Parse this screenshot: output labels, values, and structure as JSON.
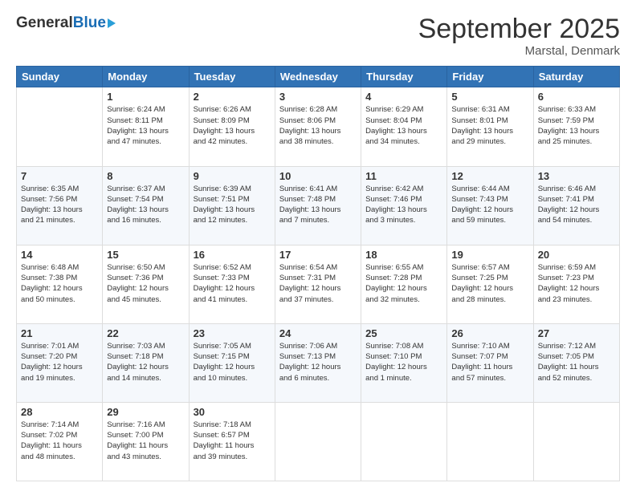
{
  "header": {
    "logo_general": "General",
    "logo_blue": "Blue",
    "title": "September 2025",
    "subtitle": "Marstal, Denmark"
  },
  "days_of_week": [
    "Sunday",
    "Monday",
    "Tuesday",
    "Wednesday",
    "Thursday",
    "Friday",
    "Saturday"
  ],
  "weeks": [
    [
      {
        "day": "",
        "info": ""
      },
      {
        "day": "1",
        "info": "Sunrise: 6:24 AM\nSunset: 8:11 PM\nDaylight: 13 hours\nand 47 minutes."
      },
      {
        "day": "2",
        "info": "Sunrise: 6:26 AM\nSunset: 8:09 PM\nDaylight: 13 hours\nand 42 minutes."
      },
      {
        "day": "3",
        "info": "Sunrise: 6:28 AM\nSunset: 8:06 PM\nDaylight: 13 hours\nand 38 minutes."
      },
      {
        "day": "4",
        "info": "Sunrise: 6:29 AM\nSunset: 8:04 PM\nDaylight: 13 hours\nand 34 minutes."
      },
      {
        "day": "5",
        "info": "Sunrise: 6:31 AM\nSunset: 8:01 PM\nDaylight: 13 hours\nand 29 minutes."
      },
      {
        "day": "6",
        "info": "Sunrise: 6:33 AM\nSunset: 7:59 PM\nDaylight: 13 hours\nand 25 minutes."
      }
    ],
    [
      {
        "day": "7",
        "info": "Sunrise: 6:35 AM\nSunset: 7:56 PM\nDaylight: 13 hours\nand 21 minutes."
      },
      {
        "day": "8",
        "info": "Sunrise: 6:37 AM\nSunset: 7:54 PM\nDaylight: 13 hours\nand 16 minutes."
      },
      {
        "day": "9",
        "info": "Sunrise: 6:39 AM\nSunset: 7:51 PM\nDaylight: 13 hours\nand 12 minutes."
      },
      {
        "day": "10",
        "info": "Sunrise: 6:41 AM\nSunset: 7:48 PM\nDaylight: 13 hours\nand 7 minutes."
      },
      {
        "day": "11",
        "info": "Sunrise: 6:42 AM\nSunset: 7:46 PM\nDaylight: 13 hours\nand 3 minutes."
      },
      {
        "day": "12",
        "info": "Sunrise: 6:44 AM\nSunset: 7:43 PM\nDaylight: 12 hours\nand 59 minutes."
      },
      {
        "day": "13",
        "info": "Sunrise: 6:46 AM\nSunset: 7:41 PM\nDaylight: 12 hours\nand 54 minutes."
      }
    ],
    [
      {
        "day": "14",
        "info": "Sunrise: 6:48 AM\nSunset: 7:38 PM\nDaylight: 12 hours\nand 50 minutes."
      },
      {
        "day": "15",
        "info": "Sunrise: 6:50 AM\nSunset: 7:36 PM\nDaylight: 12 hours\nand 45 minutes."
      },
      {
        "day": "16",
        "info": "Sunrise: 6:52 AM\nSunset: 7:33 PM\nDaylight: 12 hours\nand 41 minutes."
      },
      {
        "day": "17",
        "info": "Sunrise: 6:54 AM\nSunset: 7:31 PM\nDaylight: 12 hours\nand 37 minutes."
      },
      {
        "day": "18",
        "info": "Sunrise: 6:55 AM\nSunset: 7:28 PM\nDaylight: 12 hours\nand 32 minutes."
      },
      {
        "day": "19",
        "info": "Sunrise: 6:57 AM\nSunset: 7:25 PM\nDaylight: 12 hours\nand 28 minutes."
      },
      {
        "day": "20",
        "info": "Sunrise: 6:59 AM\nSunset: 7:23 PM\nDaylight: 12 hours\nand 23 minutes."
      }
    ],
    [
      {
        "day": "21",
        "info": "Sunrise: 7:01 AM\nSunset: 7:20 PM\nDaylight: 12 hours\nand 19 minutes."
      },
      {
        "day": "22",
        "info": "Sunrise: 7:03 AM\nSunset: 7:18 PM\nDaylight: 12 hours\nand 14 minutes."
      },
      {
        "day": "23",
        "info": "Sunrise: 7:05 AM\nSunset: 7:15 PM\nDaylight: 12 hours\nand 10 minutes."
      },
      {
        "day": "24",
        "info": "Sunrise: 7:06 AM\nSunset: 7:13 PM\nDaylight: 12 hours\nand 6 minutes."
      },
      {
        "day": "25",
        "info": "Sunrise: 7:08 AM\nSunset: 7:10 PM\nDaylight: 12 hours\nand 1 minute."
      },
      {
        "day": "26",
        "info": "Sunrise: 7:10 AM\nSunset: 7:07 PM\nDaylight: 11 hours\nand 57 minutes."
      },
      {
        "day": "27",
        "info": "Sunrise: 7:12 AM\nSunset: 7:05 PM\nDaylight: 11 hours\nand 52 minutes."
      }
    ],
    [
      {
        "day": "28",
        "info": "Sunrise: 7:14 AM\nSunset: 7:02 PM\nDaylight: 11 hours\nand 48 minutes."
      },
      {
        "day": "29",
        "info": "Sunrise: 7:16 AM\nSunset: 7:00 PM\nDaylight: 11 hours\nand 43 minutes."
      },
      {
        "day": "30",
        "info": "Sunrise: 7:18 AM\nSunset: 6:57 PM\nDaylight: 11 hours\nand 39 minutes."
      },
      {
        "day": "",
        "info": ""
      },
      {
        "day": "",
        "info": ""
      },
      {
        "day": "",
        "info": ""
      },
      {
        "day": "",
        "info": ""
      }
    ]
  ]
}
